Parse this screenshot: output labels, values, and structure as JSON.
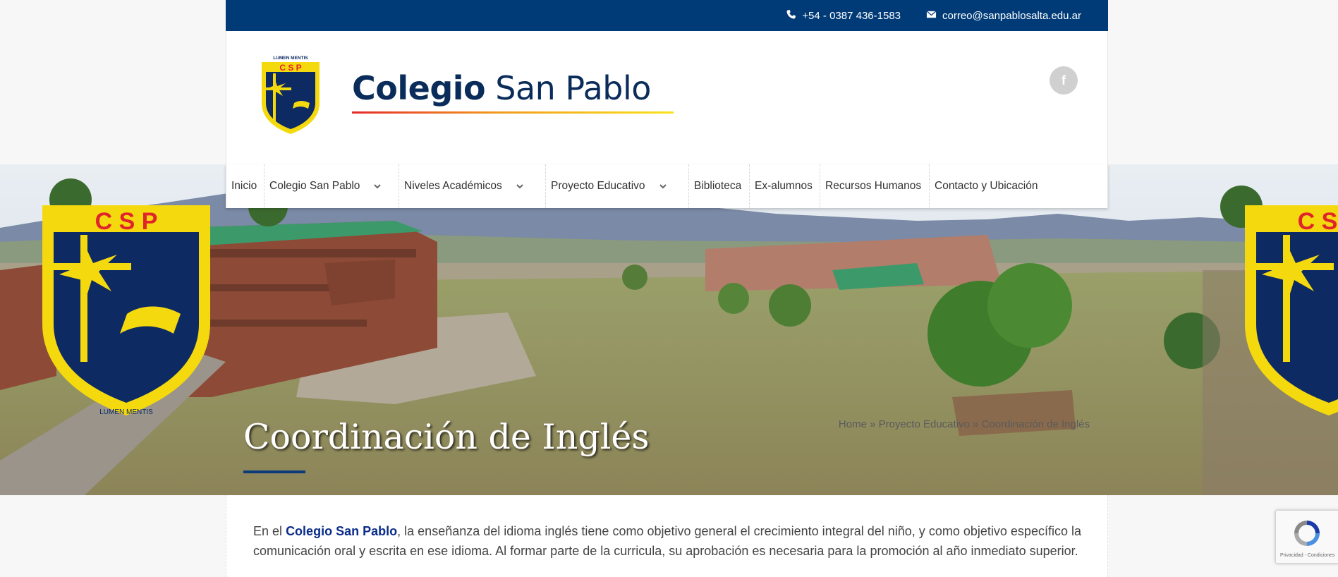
{
  "topbar": {
    "phone": "+54 - 0387 436-1583",
    "email": "correo@sanpablosalta.edu.ar"
  },
  "header": {
    "brand_bold": "Colegio",
    "brand_rest": " San Pablo",
    "crest_letters": "C S P",
    "crest_motto": "LUMEN MENTIS",
    "social_icon": "f"
  },
  "nav": {
    "items": [
      {
        "label": "Inicio",
        "has_dropdown": false
      },
      {
        "label": "Colegio San Pablo",
        "has_dropdown": true
      },
      {
        "label": "Niveles Académicos",
        "has_dropdown": true
      },
      {
        "label": "Proyecto Educativo",
        "has_dropdown": true
      },
      {
        "label": "Biblioteca",
        "has_dropdown": false
      },
      {
        "label": "Ex-alumnos",
        "has_dropdown": false
      },
      {
        "label": "Recursos Humanos",
        "has_dropdown": false
      },
      {
        "label": "Contacto y Ubicación",
        "has_dropdown": false
      }
    ]
  },
  "hero": {
    "title": "Coordinación de Inglés",
    "crest_letters": "C S P",
    "crest_motto": "LUMEN MENTIS",
    "breadcrumb": {
      "home": "Home",
      "sep1": " » ",
      "parent": "Proyecto Educativo",
      "sep2": " » ",
      "current": "Coordinación de Inglés"
    }
  },
  "content": {
    "intro_before": "En el ",
    "intro_bold": "Colegio San Pablo",
    "intro_after": ", la enseñanza del idioma inglés tiene como objetivo general el crecimiento integral del niño, y como objetivo específico la comunicación oral y escrita en ese idioma. Al formar parte de la curricula, su aprobación es necesaria para la promoción al año inmediato superior."
  },
  "recaptcha": {
    "footer": "Privacidad - Condiciones"
  },
  "colors": {
    "brand_blue": "#003b77",
    "crest_yellow": "#f5d90f",
    "crest_navy": "#0d2a63",
    "crest_red": "#e0242b"
  }
}
